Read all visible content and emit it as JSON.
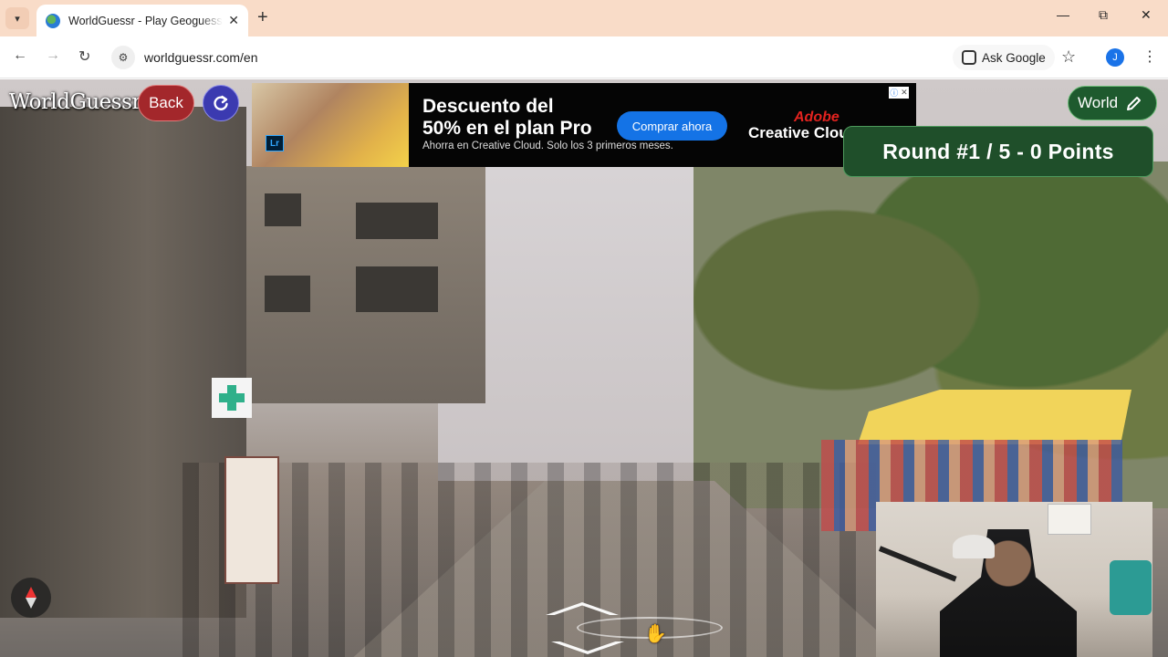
{
  "browser": {
    "tab_title": "WorldGuessr - Play Geoguessr Free",
    "url": "worldguessr.com/en",
    "ask_google": "Ask Google",
    "profile_initial": "J"
  },
  "game": {
    "logo": "WorldGuessr",
    "back_label": "Back",
    "map_mode": "World",
    "round_status": "Round #1 / 5 - 0 Points"
  },
  "ad": {
    "headline_line1": "Descuento del",
    "headline_line2": "50% en el plan Pro",
    "subtext": "Ahorra en Creative Cloud. Solo los 3 primeros meses.",
    "cta": "Comprar ahora",
    "brand_line1": "Adobe",
    "brand_line2": "Creative Cloud",
    "app_badge": "Lr"
  },
  "icons": {
    "tab_menu": "chevron-down-icon",
    "favicon": "globe-icon",
    "refresh": "refresh-icon",
    "edit": "pencil-icon",
    "compass": "compass-icon"
  },
  "colors": {
    "tabbar_bg": "#f9dcc8",
    "back_btn": "#a3272b",
    "refresh_btn": "#3b3ab0",
    "round_box": "#1f4f2a",
    "ad_cta": "#1473e6",
    "adobe_red": "#e3231f"
  }
}
